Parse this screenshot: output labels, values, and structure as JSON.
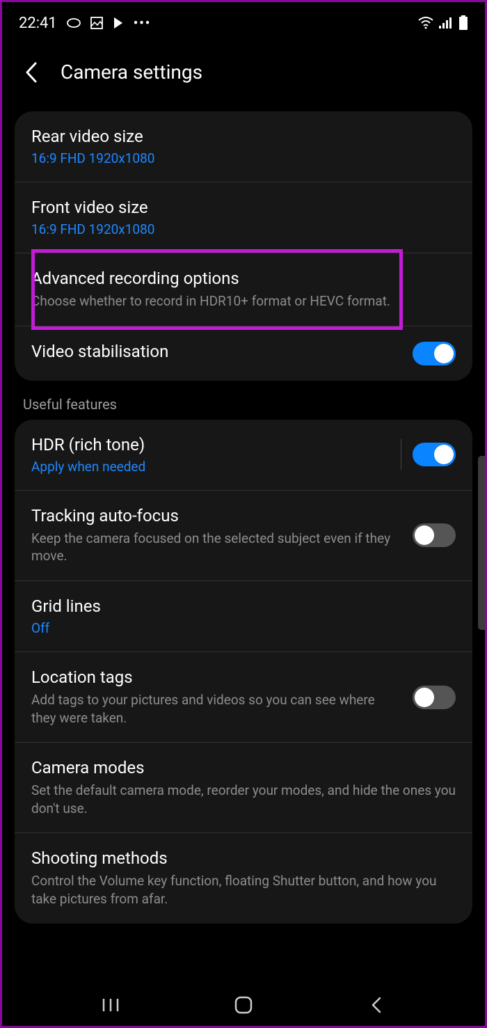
{
  "status": {
    "time": "22:41",
    "icons_left": [
      "message-icon",
      "image-icon",
      "play-icon",
      "more-icon"
    ],
    "icons_right": [
      "wifi-icon",
      "signal-icon",
      "battery-icon"
    ]
  },
  "header": {
    "title": "Camera settings"
  },
  "group1": {
    "rear_video": {
      "title": "Rear video size",
      "value": "16:9 FHD 1920x1080"
    },
    "front_video": {
      "title": "Front video size",
      "value": "16:9 FHD 1920x1080"
    },
    "advanced": {
      "title": "Advanced recording options",
      "desc": "Choose whether to record in HDR10+ format or HEVC format."
    },
    "stabilisation": {
      "title": "Video stabilisation",
      "toggle": true
    }
  },
  "section2_title": "Useful features",
  "group2": {
    "hdr": {
      "title": "HDR (rich tone)",
      "value": "Apply when needed",
      "toggle": true
    },
    "tracking": {
      "title": "Tracking auto-focus",
      "desc": "Keep the camera focused on the selected subject even if they move.",
      "toggle": false
    },
    "grid": {
      "title": "Grid lines",
      "value": "Off"
    },
    "location": {
      "title": "Location tags",
      "desc": "Add tags to your pictures and videos so you can see where they were taken.",
      "toggle": false
    },
    "camera_modes": {
      "title": "Camera modes",
      "desc": "Set the default camera mode, reorder your modes, and hide the ones you don't use."
    },
    "shooting": {
      "title": "Shooting methods",
      "desc": "Control the Volume key function, floating Shutter button, and how you take pictures from afar."
    }
  }
}
